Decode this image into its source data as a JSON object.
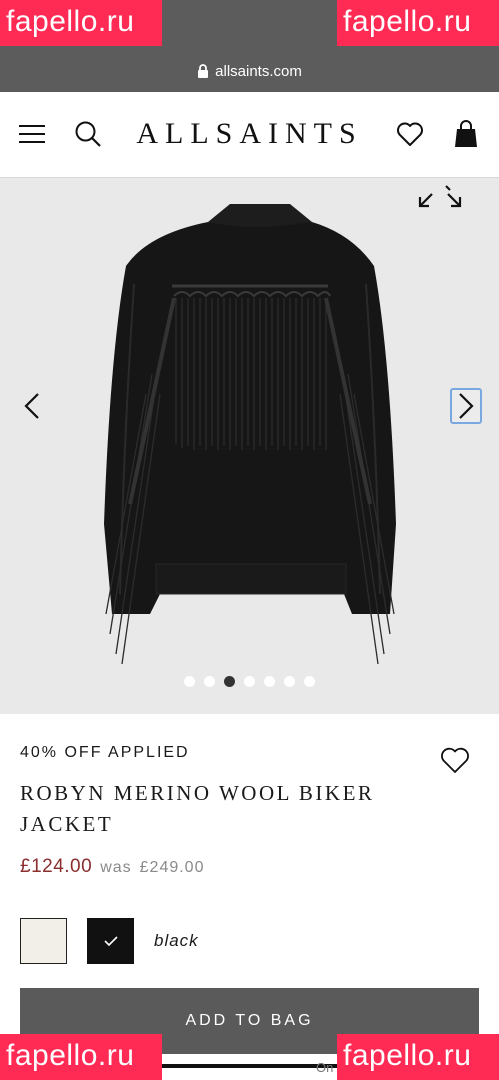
{
  "browser": {
    "url": "allsaints.com"
  },
  "watermarks": {
    "top_left": "fapello.ru",
    "top_right": "fapello.ru",
    "bottom_left": "fapello.ru",
    "bottom_right": "fapello.ru"
  },
  "header": {
    "logo": "ALLSAINTS",
    "icons": [
      "menu-icon",
      "search-icon",
      "heart-icon",
      "bag-icon"
    ]
  },
  "gallery": {
    "image_count": 7,
    "active_index": 2,
    "icons": [
      "expand-icon",
      "chevron-left-icon",
      "chevron-right-icon"
    ]
  },
  "product": {
    "promo": "40% OFF APPLIED",
    "title": "ROBYN MERINO WOOL BIKER JACKET",
    "price_now": "£124.00",
    "was_label": "was",
    "price_was": "£249.00",
    "selected_color": "black",
    "add_to_bag": "ADD TO BAG",
    "bottom_text": "On"
  },
  "colors": {
    "browser_chrome": "#5c5c5c",
    "watermark": "#ff2b55",
    "sale_price": "#8b2e2e",
    "add_to_bag": "#5a5a5a"
  }
}
